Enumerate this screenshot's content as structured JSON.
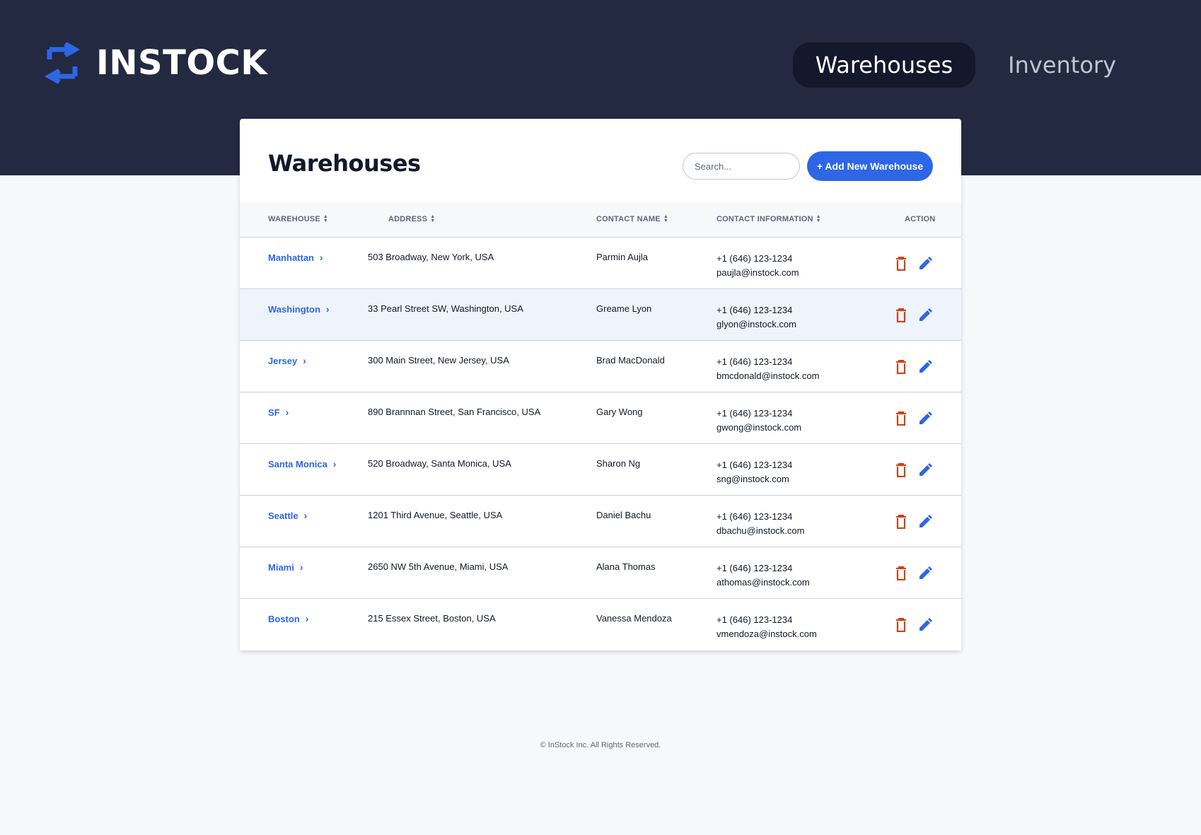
{
  "header": {
    "logo_text": "INSTOCK",
    "nav": [
      {
        "label": "Warehouses",
        "active": true
      },
      {
        "label": "Inventory",
        "active": false
      }
    ]
  },
  "page": {
    "title": "Warehouses",
    "search_placeholder": "Search...",
    "add_button": "+ Add New Warehouse"
  },
  "table": {
    "columns": {
      "warehouse": "WAREHOUSE",
      "address": "ADDRESS",
      "contact_name": "CONTACT NAME",
      "contact_info": "CONTACT INFORMATION",
      "action": "ACTION"
    },
    "rows": [
      {
        "warehouse": "Manhattan",
        "address": "503 Broadway, New York, USA",
        "contact_name": "Parmin Aujla",
        "phone": "+1 (646) 123-1234",
        "email": "paujla@instock.com"
      },
      {
        "warehouse": "Washington",
        "address": "33 Pearl Street SW, Washington, USA",
        "contact_name": "Greame Lyon",
        "phone": "+1 (646) 123-1234",
        "email": "glyon@instock.com"
      },
      {
        "warehouse": "Jersey",
        "address": "300 Main Street, New Jersey, USA",
        "contact_name": "Brad MacDonald",
        "phone": "+1 (646) 123-1234",
        "email": "bmcdonald@instock.com"
      },
      {
        "warehouse": "SF",
        "address": "890 Brannnan Street, San Francisco, USA",
        "contact_name": "Gary Wong",
        "phone": "+1 (646) 123-1234",
        "email": "gwong@instock.com"
      },
      {
        "warehouse": "Santa Monica",
        "address": "520 Broadway, Santa Monica, USA",
        "contact_name": "Sharon Ng",
        "phone": "+1 (646) 123-1234",
        "email": "sng@instock.com"
      },
      {
        "warehouse": "Seattle",
        "address": "1201 Third Avenue, Seattle, USA",
        "contact_name": "Daniel Bachu",
        "phone": "+1 (646) 123-1234",
        "email": "dbachu@instock.com"
      },
      {
        "warehouse": "Miami",
        "address": "2650 NW 5th Avenue, Miami, USA",
        "contact_name": "Alana Thomas",
        "phone": "+1 (646) 123-1234",
        "email": "athomas@instock.com"
      },
      {
        "warehouse": "Boston",
        "address": "215 Essex Street, Boston, USA",
        "contact_name": "Vanessa Mendoza",
        "phone": "+1 (646) 123-1234",
        "email": "vmendoza@instock.com"
      }
    ]
  },
  "footer": {
    "text": "© InStock Inc. All Rights Reserved."
  },
  "colors": {
    "header_bg": "#232940",
    "accent": "#2e66e5",
    "delete": "#c94515"
  },
  "icons": {
    "logo": "swap-arrows-icon",
    "warehouse_link": "chevron-right-icon",
    "delete": "trash-icon",
    "edit": "pencil-icon"
  }
}
